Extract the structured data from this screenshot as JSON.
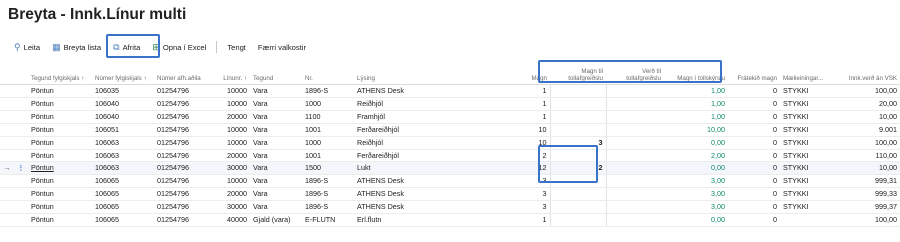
{
  "page": {
    "title": "Breyta - Innk.Línur multi"
  },
  "toolbar": {
    "search": "Leita",
    "edit_list": "Breyta lista",
    "copy": "Afrita",
    "excel": "Opna í Excel",
    "linked": "Tengt",
    "fewer": "Færri valkostir",
    "icons": [
      "search-icon",
      "edit-list-icon",
      "copy-icon",
      "excel-icon"
    ]
  },
  "grid": {
    "columns": [
      "Tegund fylgiskjals ↑",
      "Númer fylgiskjals ↑",
      "Númer afh.aðila",
      "Línunr. ↑",
      "Tegund",
      "Nr.",
      "Lýsing",
      "Magn",
      "Magn til tollafgreiðslu",
      "Verð til tollafgreiðslu",
      "Magn í tollskýrslu",
      "Frátekið magn",
      "Mælieiningar...",
      "Innk.verð án VSK"
    ],
    "rows": [
      [
        "Pöntun",
        "106035",
        "01254796",
        "10000",
        "Vara",
        "1896-S",
        "ATHENS Desk",
        "1",
        "",
        "",
        "1,00",
        "0",
        "STYKKI",
        "100,00"
      ],
      [
        "Pöntun",
        "106040",
        "01254796",
        "10000",
        "Vara",
        "1000",
        "Reiðhjól",
        "1",
        "",
        "",
        "1,00",
        "0",
        "STYKKI",
        "20,00"
      ],
      [
        "Pöntun",
        "106040",
        "01254796",
        "20000",
        "Vara",
        "1100",
        "Framhjól",
        "1",
        "",
        "",
        "1,00",
        "0",
        "STYKKI",
        "10,00"
      ],
      [
        "Pöntun",
        "106051",
        "01254796",
        "10000",
        "Vara",
        "1001",
        "Ferðareiðhjól",
        "10",
        "",
        "",
        "10,00",
        "0",
        "STYKKI",
        "9.001"
      ],
      [
        "Pöntun",
        "106063",
        "01254796",
        "10000",
        "Vara",
        "1000",
        "Reiðhjól",
        "10",
        "3",
        "",
        "0,00",
        "0",
        "STYKKI",
        "100,00"
      ],
      [
        "Pöntun",
        "106063",
        "01254796",
        "20000",
        "Vara",
        "1001",
        "Ferðareiðhjól",
        "2",
        "",
        "",
        "2,00",
        "0",
        "STYKKI",
        "110,00"
      ],
      [
        "Pöntun",
        "106063",
        "01254796",
        "30000",
        "Vara",
        "1500",
        "Lukt",
        "12",
        "2",
        "",
        "0,00",
        "0",
        "STYKKI",
        "10,00"
      ],
      [
        "Pöntun",
        "106065",
        "01254796",
        "10000",
        "Vara",
        "1896-S",
        "ATHENS Desk",
        "3",
        "",
        "",
        "3,00",
        "0",
        "STYKKI",
        "999,31"
      ],
      [
        "Pöntun",
        "106065",
        "01254796",
        "20000",
        "Vara",
        "1896-S",
        "ATHENS Desk",
        "3",
        "",
        "",
        "3,00",
        "0",
        "STYKKI",
        "999,33"
      ],
      [
        "Pöntun",
        "106065",
        "01254796",
        "30000",
        "Vara",
        "1896-S",
        "ATHENS Desk",
        "3",
        "",
        "",
        "3,00",
        "0",
        "STYKKI",
        "999,37"
      ],
      [
        "Pöntun",
        "106065",
        "01254796",
        "40000",
        "Gjald (vara)",
        "E-FLUTN",
        "Erl.flutn",
        "1",
        "",
        "",
        "0,00",
        "0",
        "",
        "100,00"
      ]
    ],
    "active_row": 6,
    "row_marker": "→",
    "row_menu": "⋮"
  },
  "colors": {
    "accent": "#3b72c9",
    "green_value": "#0f8a6a",
    "active_row_bg": "#f3f6fb"
  }
}
